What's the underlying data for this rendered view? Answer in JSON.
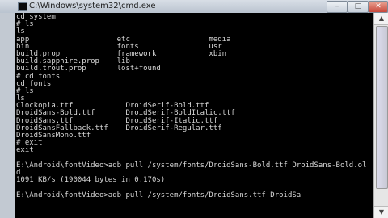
{
  "window": {
    "title": "C:\\Windows\\system32\\cmd.exe",
    "min_label": "–",
    "max_label": "□",
    "close_label": "✕"
  },
  "console": {
    "lines": [
      "cd system",
      "# ls",
      "ls",
      "app                    etc                  media",
      "bin                    fonts                usr",
      "build.prop             framework            xbin",
      "build.sapphire.prop    lib",
      "build.trout.prop       lost+found",
      "# cd fonts",
      "cd fonts",
      "# ls",
      "ls",
      "Clockopia.ttf            DroidSerif-Bold.ttf",
      "DroidSans-Bold.ttf       DroidSerif-BoldItalic.ttf",
      "DroidSans.ttf            DroidSerif-Italic.ttf",
      "DroidSansFallback.ttf    DroidSerif-Regular.ttf",
      "DroidSansMono.ttf",
      "# exit",
      "exit",
      "",
      "E:\\Android\\fontVideo>adb pull /system/fonts/DroidSans-Bold.ttf DroidSans-Bold.ol",
      "d",
      "1091 KB/s (190044 bytes in 0.170s)",
      "",
      "E:\\Android\\fontVideo>adb pull /system/fonts/DroidSans.ttf DroidSa"
    ]
  },
  "scrollbar": {
    "up_label": "▲",
    "down_label": "▼"
  }
}
